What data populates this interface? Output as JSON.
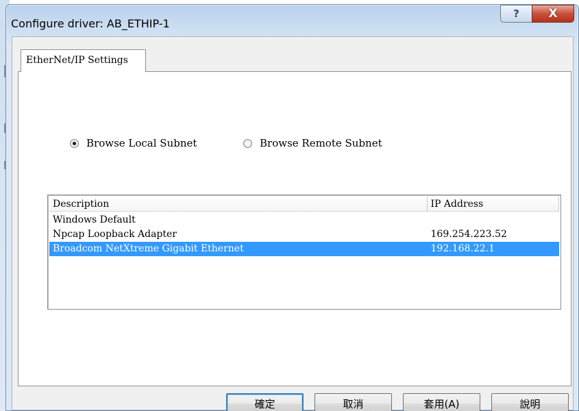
{
  "window": {
    "title": "Configure driver: AB_ETHIP-1",
    "help_glyph": "?",
    "close_glyph": "X"
  },
  "tabs": [
    {
      "label": "EtherNet/IP Settings",
      "selected": true
    }
  ],
  "browse_options": [
    {
      "label": "Browse Local Subnet",
      "checked": true
    },
    {
      "label": "Browse Remote Subnet",
      "checked": false
    }
  ],
  "adapter_list": {
    "columns": [
      "Description",
      "IP Address"
    ],
    "rows": [
      {
        "description": "Windows Default",
        "ip": ""
      },
      {
        "description": "Npcap Loopback Adapter",
        "ip": "169.254.223.52"
      },
      {
        "description": "Broadcom NetXtreme Gigabit Ethernet",
        "ip": "192.168.22.1",
        "selected": true
      }
    ]
  },
  "buttons": {
    "ok": "確定",
    "cancel": "取消",
    "apply": "套用(A)",
    "help": "說明"
  },
  "colors": {
    "selection": "#3399ff",
    "close_button": "#c7503b"
  },
  "icons": {
    "help": "help-icon",
    "close": "close-icon"
  }
}
